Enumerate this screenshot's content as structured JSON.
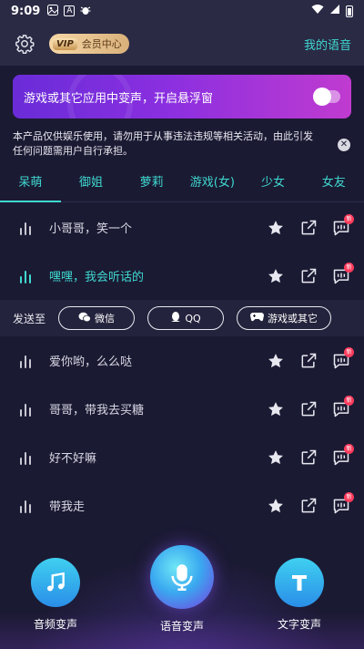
{
  "status_bar": {
    "time": "9:09"
  },
  "header": {
    "vip_tag": "VIP",
    "vip_label": "会员中心",
    "my_voice": "我的语音"
  },
  "banner": {
    "text": "游戏或其它应用中变声，开启悬浮窗",
    "toggle_on": false
  },
  "notice": {
    "text": "本产品仅供娱乐使用，请勿用于从事违法违规等相关活动，由此引发任何问题需用户自行承担。"
  },
  "tabs": [
    {
      "label": "呆萌",
      "active": true
    },
    {
      "label": "御姐",
      "active": false
    },
    {
      "label": "萝莉",
      "active": false
    },
    {
      "label": "游戏(女)",
      "active": false
    },
    {
      "label": "少女",
      "active": false
    },
    {
      "label": "女友",
      "active": false
    }
  ],
  "voices": [
    {
      "label": "小哥哥，笑一个",
      "selected": false
    },
    {
      "label": "嘿嘿，我会听话的",
      "selected": true
    },
    {
      "label": "爱你哟，么么哒",
      "selected": false
    },
    {
      "label": "哥哥，带我去买糖",
      "selected": false
    },
    {
      "label": "好不好嘛",
      "selected": false
    },
    {
      "label": "带我走",
      "selected": false
    }
  ],
  "send_bar": {
    "label": "发送至",
    "wechat": "微信",
    "qq": "QQ",
    "games": "游戏或其它"
  },
  "new_badge": "新",
  "bottom_nav": {
    "audio": "音频变声",
    "voice": "语音变声",
    "text": "文字变声"
  },
  "colors": {
    "accent": "#3fd9d0",
    "background": "#1b1a33",
    "banner_start": "#6a2cd8",
    "banner_end": "#c03bd0"
  }
}
